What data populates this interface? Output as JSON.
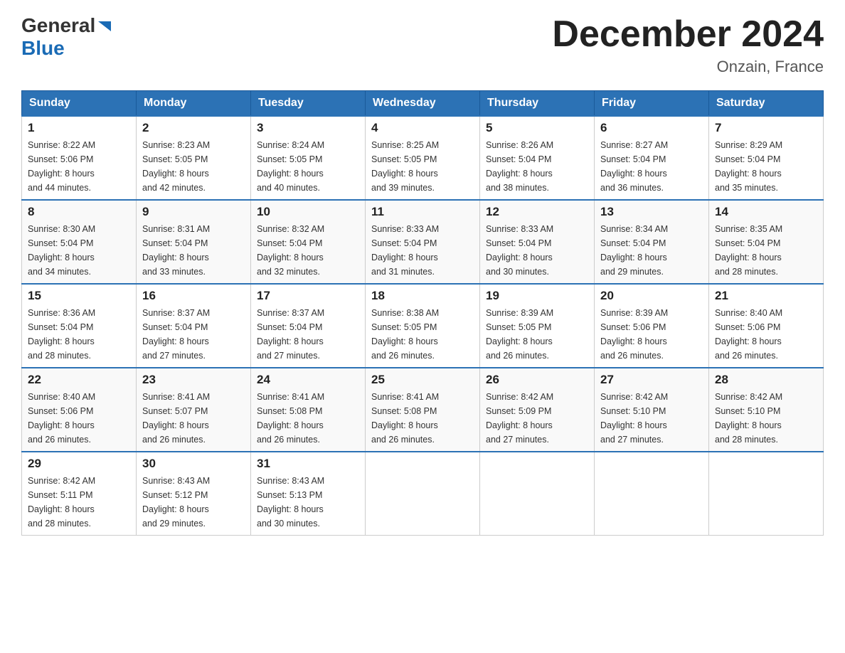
{
  "header": {
    "logo_general": "General",
    "logo_blue": "Blue",
    "month_title": "December 2024",
    "location": "Onzain, France"
  },
  "weekdays": [
    "Sunday",
    "Monday",
    "Tuesday",
    "Wednesday",
    "Thursday",
    "Friday",
    "Saturday"
  ],
  "weeks": [
    [
      {
        "day": "1",
        "sunrise": "8:22 AM",
        "sunset": "5:06 PM",
        "daylight": "8 hours and 44 minutes."
      },
      {
        "day": "2",
        "sunrise": "8:23 AM",
        "sunset": "5:05 PM",
        "daylight": "8 hours and 42 minutes."
      },
      {
        "day": "3",
        "sunrise": "8:24 AM",
        "sunset": "5:05 PM",
        "daylight": "8 hours and 40 minutes."
      },
      {
        "day": "4",
        "sunrise": "8:25 AM",
        "sunset": "5:05 PM",
        "daylight": "8 hours and 39 minutes."
      },
      {
        "day": "5",
        "sunrise": "8:26 AM",
        "sunset": "5:04 PM",
        "daylight": "8 hours and 38 minutes."
      },
      {
        "day": "6",
        "sunrise": "8:27 AM",
        "sunset": "5:04 PM",
        "daylight": "8 hours and 36 minutes."
      },
      {
        "day": "7",
        "sunrise": "8:29 AM",
        "sunset": "5:04 PM",
        "daylight": "8 hours and 35 minutes."
      }
    ],
    [
      {
        "day": "8",
        "sunrise": "8:30 AM",
        "sunset": "5:04 PM",
        "daylight": "8 hours and 34 minutes."
      },
      {
        "day": "9",
        "sunrise": "8:31 AM",
        "sunset": "5:04 PM",
        "daylight": "8 hours and 33 minutes."
      },
      {
        "day": "10",
        "sunrise": "8:32 AM",
        "sunset": "5:04 PM",
        "daylight": "8 hours and 32 minutes."
      },
      {
        "day": "11",
        "sunrise": "8:33 AM",
        "sunset": "5:04 PM",
        "daylight": "8 hours and 31 minutes."
      },
      {
        "day": "12",
        "sunrise": "8:33 AM",
        "sunset": "5:04 PM",
        "daylight": "8 hours and 30 minutes."
      },
      {
        "day": "13",
        "sunrise": "8:34 AM",
        "sunset": "5:04 PM",
        "daylight": "8 hours and 29 minutes."
      },
      {
        "day": "14",
        "sunrise": "8:35 AM",
        "sunset": "5:04 PM",
        "daylight": "8 hours and 28 minutes."
      }
    ],
    [
      {
        "day": "15",
        "sunrise": "8:36 AM",
        "sunset": "5:04 PM",
        "daylight": "8 hours and 28 minutes."
      },
      {
        "day": "16",
        "sunrise": "8:37 AM",
        "sunset": "5:04 PM",
        "daylight": "8 hours and 27 minutes."
      },
      {
        "day": "17",
        "sunrise": "8:37 AM",
        "sunset": "5:04 PM",
        "daylight": "8 hours and 27 minutes."
      },
      {
        "day": "18",
        "sunrise": "8:38 AM",
        "sunset": "5:05 PM",
        "daylight": "8 hours and 26 minutes."
      },
      {
        "day": "19",
        "sunrise": "8:39 AM",
        "sunset": "5:05 PM",
        "daylight": "8 hours and 26 minutes."
      },
      {
        "day": "20",
        "sunrise": "8:39 AM",
        "sunset": "5:06 PM",
        "daylight": "8 hours and 26 minutes."
      },
      {
        "day": "21",
        "sunrise": "8:40 AM",
        "sunset": "5:06 PM",
        "daylight": "8 hours and 26 minutes."
      }
    ],
    [
      {
        "day": "22",
        "sunrise": "8:40 AM",
        "sunset": "5:06 PM",
        "daylight": "8 hours and 26 minutes."
      },
      {
        "day": "23",
        "sunrise": "8:41 AM",
        "sunset": "5:07 PM",
        "daylight": "8 hours and 26 minutes."
      },
      {
        "day": "24",
        "sunrise": "8:41 AM",
        "sunset": "5:08 PM",
        "daylight": "8 hours and 26 minutes."
      },
      {
        "day": "25",
        "sunrise": "8:41 AM",
        "sunset": "5:08 PM",
        "daylight": "8 hours and 26 minutes."
      },
      {
        "day": "26",
        "sunrise": "8:42 AM",
        "sunset": "5:09 PM",
        "daylight": "8 hours and 27 minutes."
      },
      {
        "day": "27",
        "sunrise": "8:42 AM",
        "sunset": "5:10 PM",
        "daylight": "8 hours and 27 minutes."
      },
      {
        "day": "28",
        "sunrise": "8:42 AM",
        "sunset": "5:10 PM",
        "daylight": "8 hours and 28 minutes."
      }
    ],
    [
      {
        "day": "29",
        "sunrise": "8:42 AM",
        "sunset": "5:11 PM",
        "daylight": "8 hours and 28 minutes."
      },
      {
        "day": "30",
        "sunrise": "8:43 AM",
        "sunset": "5:12 PM",
        "daylight": "8 hours and 29 minutes."
      },
      {
        "day": "31",
        "sunrise": "8:43 AM",
        "sunset": "5:13 PM",
        "daylight": "8 hours and 30 minutes."
      },
      null,
      null,
      null,
      null
    ]
  ],
  "labels": {
    "sunrise": "Sunrise:",
    "sunset": "Sunset:",
    "daylight": "Daylight:"
  }
}
